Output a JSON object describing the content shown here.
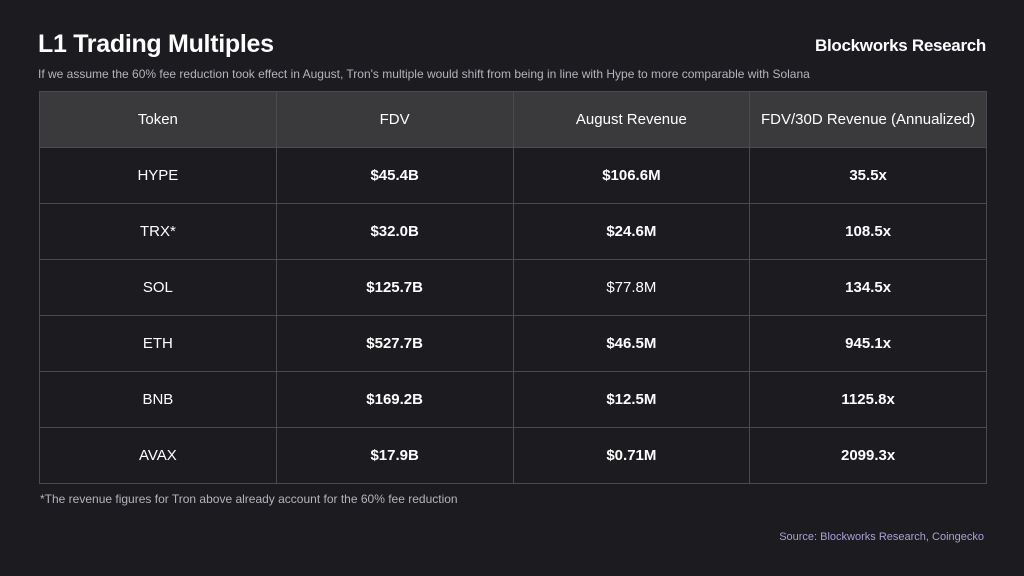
{
  "header": {
    "title": "L1 Trading Multiples",
    "brand": "Blockworks Research",
    "subtitle": "If we assume the 60% fee reduction took effect in August, Tron's multiple would shift from being in line with Hype to more comparable with Solana"
  },
  "chart_data": {
    "type": "table",
    "columns": [
      "Token",
      "FDV",
      "August Revenue",
      "FDV/30D Revenue (Annualized)"
    ],
    "rows": [
      [
        "HYPE",
        "$45.4B",
        "$106.6M",
        "35.5x"
      ],
      [
        "TRX*",
        "$32.0B",
        "$24.6M",
        "108.5x"
      ],
      [
        "SOL",
        "$125.7B",
        "$77.8M",
        "134.5x"
      ],
      [
        "ETH",
        "$527.7B",
        "$46.5M",
        "945.1x"
      ],
      [
        "BNB",
        "$169.2B",
        "$12.5M",
        "1125.8x"
      ],
      [
        "AVAX",
        "$17.9B",
        "$0.71M",
        "2099.3x"
      ]
    ]
  },
  "footer": {
    "footnote": "*The revenue figures for Tron above already account for the 60% fee reduction",
    "source": "Source: Blockworks Research, Coingecko"
  },
  "colors": {
    "background": "#1c1b20",
    "header_row": "#3a3a3c",
    "grid": "#4a4a50",
    "source_text": "#a8a1d6"
  }
}
